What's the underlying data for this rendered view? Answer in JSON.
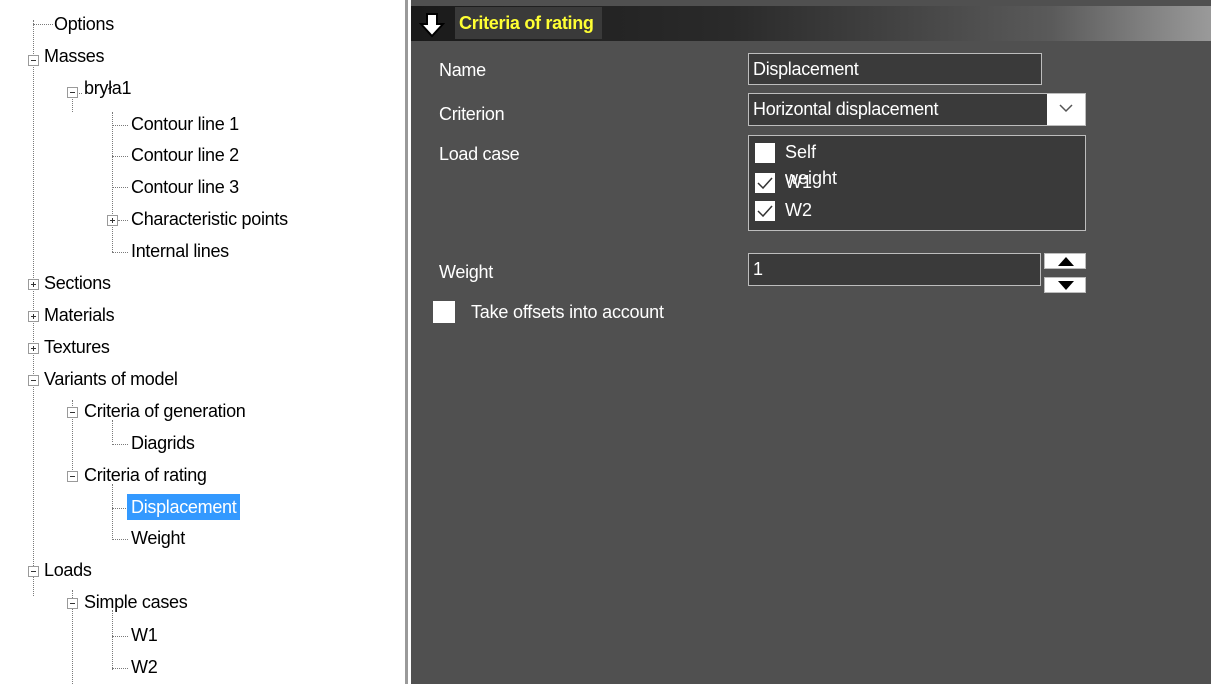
{
  "tree": {
    "nodes": {
      "options": "Options",
      "masses": "Masses",
      "bryla1": "bryła1",
      "contour1": "Contour line 1",
      "contour2": "Contour line 2",
      "contour3": "Contour line 3",
      "char_points": "Characteristic points",
      "internal_lines": "Internal lines",
      "sections": "Sections",
      "materials": "Materials",
      "textures": "Textures",
      "variants": "Variants of model",
      "crit_generation": "Criteria of generation",
      "diagrids": "Diagrids",
      "crit_rating": "Criteria of rating",
      "displacement": "Displacement",
      "weight": "Weight",
      "loads": "Loads",
      "simple_cases": "Simple cases",
      "w1": "W1",
      "w2": "W2"
    },
    "selected": "Displacement"
  },
  "panel": {
    "header_title": "Criteria of rating",
    "header_icon": "down-arrow-icon",
    "name_label": "Name",
    "name_value": "Displacement",
    "criterion_label": "Criterion",
    "criterion_value": "Horizontal displacement",
    "loadcase_label": "Load case",
    "load_cases": [
      {
        "label": "Self weight",
        "checked": false
      },
      {
        "label": "W1",
        "checked": true
      },
      {
        "label": "W2",
        "checked": true
      }
    ],
    "weight_label": "Weight",
    "weight_value": "1",
    "offsets_label": "Take offsets into account",
    "offsets_checked": false
  },
  "colors": {
    "panel_bg": "#505050",
    "field_bg": "#3a3a3a",
    "header_title": "#ffff33",
    "selection": "#3399ff"
  }
}
